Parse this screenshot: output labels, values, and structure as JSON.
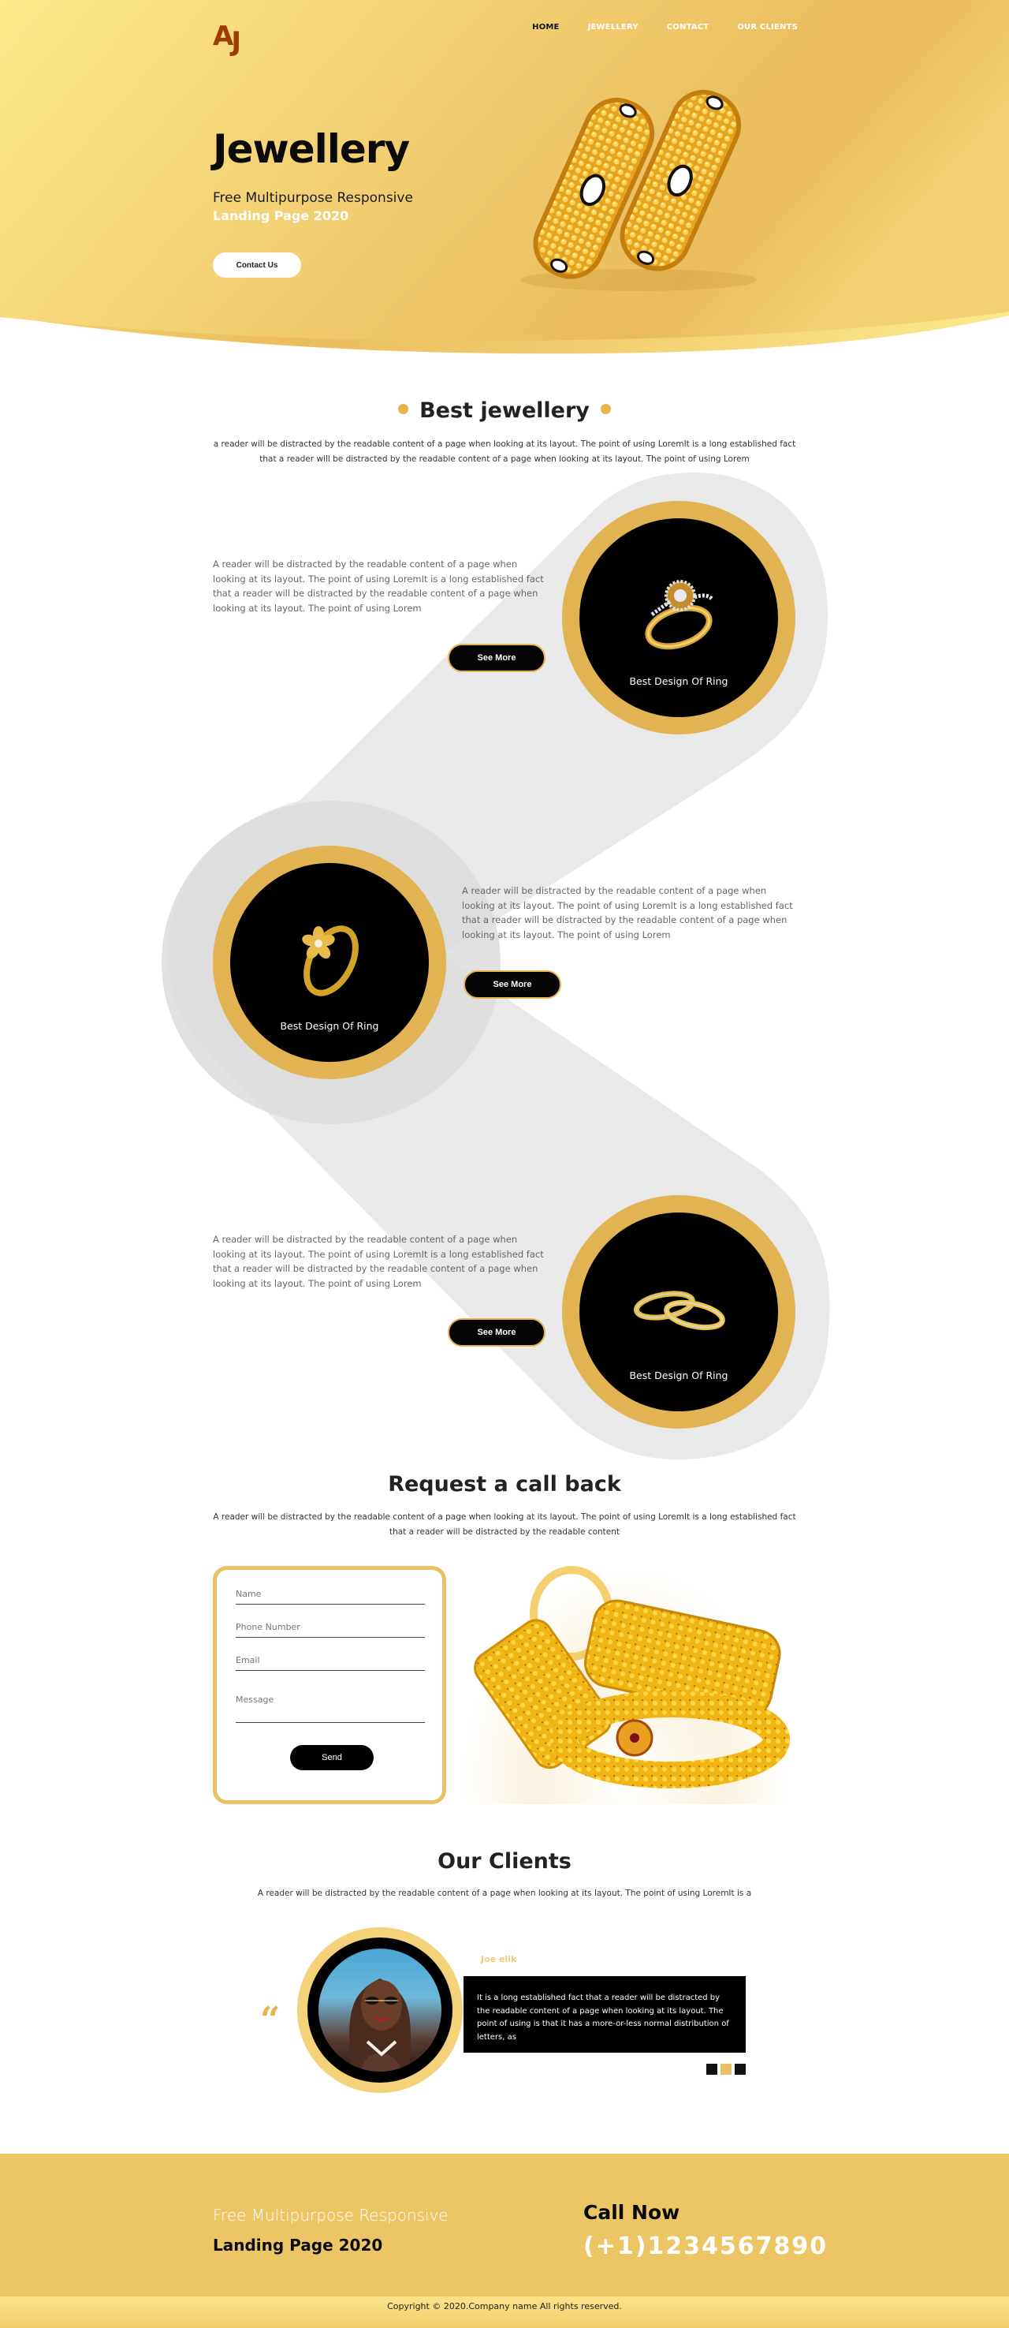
{
  "brand": {
    "logo_a": "A",
    "logo_j": "J",
    "colors": {
      "gold": "#e9b34c",
      "gold_light": "#fce68a",
      "logo_brown": "#9c3d06",
      "black": "#000000",
      "band_grey": "#e8e8e8"
    }
  },
  "nav": {
    "items": [
      {
        "label": "HOME",
        "active": true
      },
      {
        "label": "JEWELLERY",
        "active": false
      },
      {
        "label": "CONTACT",
        "active": false
      },
      {
        "label": "OUR CLIENTS",
        "active": false
      }
    ]
  },
  "hero": {
    "title": "Jewellery",
    "subtitle_line1": "Free Multipurpose Responsive",
    "subtitle_line2": "Landing Page 2020",
    "cta_label": "Contact Us",
    "image_icon": "gold-bangles-image"
  },
  "best": {
    "title": "Best jewellery",
    "description": "a reader will be distracted by the readable content of a page when looking at its layout. The point of using LoremIt is a long established fact that a reader will be distracted by the readable content of a page when looking at its layout. The point of using Lorem",
    "features": [
      {
        "text": "A reader will be distracted by the readable content of a page when looking at its layout. The point of using LoremIt is a long established fact that a reader will be distracted by the readable content of a page when looking at its layout. The point of using Lorem",
        "button": "See More",
        "caption": "Best Design Of Ring",
        "image_icon": "diamond-ring-image"
      },
      {
        "text": "A reader will be distracted by the readable content of a page when looking at its layout. The point of using LoremIt is a long established fact that a reader will be distracted by the readable content of a page when looking at its layout. The point of using Lorem",
        "button": "See More",
        "caption": "Best Design Of Ring",
        "image_icon": "flower-ring-image"
      },
      {
        "text": "A reader will be distracted by the readable content of a page when looking at its layout. The point of using LoremIt is a long established fact that a reader will be distracted by the readable content of a page when looking at its layout. The point of using Lorem",
        "button": "See More",
        "caption": "Best Design Of Ring",
        "image_icon": "wedding-bands-image"
      }
    ]
  },
  "callback": {
    "title": "Request a call back",
    "description": "A reader will be distracted by the readable content of a page when looking at its layout. The point of using LoremIt is a long established fact that a reader will be distracted by the readable content",
    "form": {
      "name_placeholder": "Name",
      "phone_placeholder": "Phone Number",
      "email_placeholder": "Email",
      "message_placeholder": "Message",
      "send_label": "Send"
    },
    "image_icon": "gold-bangles-photo"
  },
  "clients": {
    "title": "Our Clients",
    "description": "A reader will be distracted by the readable content of a page when looking at its layout. The point of using LoremIt is a",
    "quote_mark": "“",
    "testimonial": {
      "name": "Joe elik",
      "text": "It is a long established fact that a reader will be distracted by the readable content of a page when looking at its layout. The point of using is that it has a more-or-less normal distribution of letters, as",
      "avatar_icon": "client-avatar-photo"
    },
    "pager": {
      "count": 3,
      "active_index": 1
    }
  },
  "footer": {
    "line1": "Free Multipurpose Responsive",
    "line2": "Landing Page 2020",
    "call_title": "Call Now",
    "phone": "(+1)1234567890",
    "copyright": "Copyright © 2020.Company name All rights reserved."
  }
}
